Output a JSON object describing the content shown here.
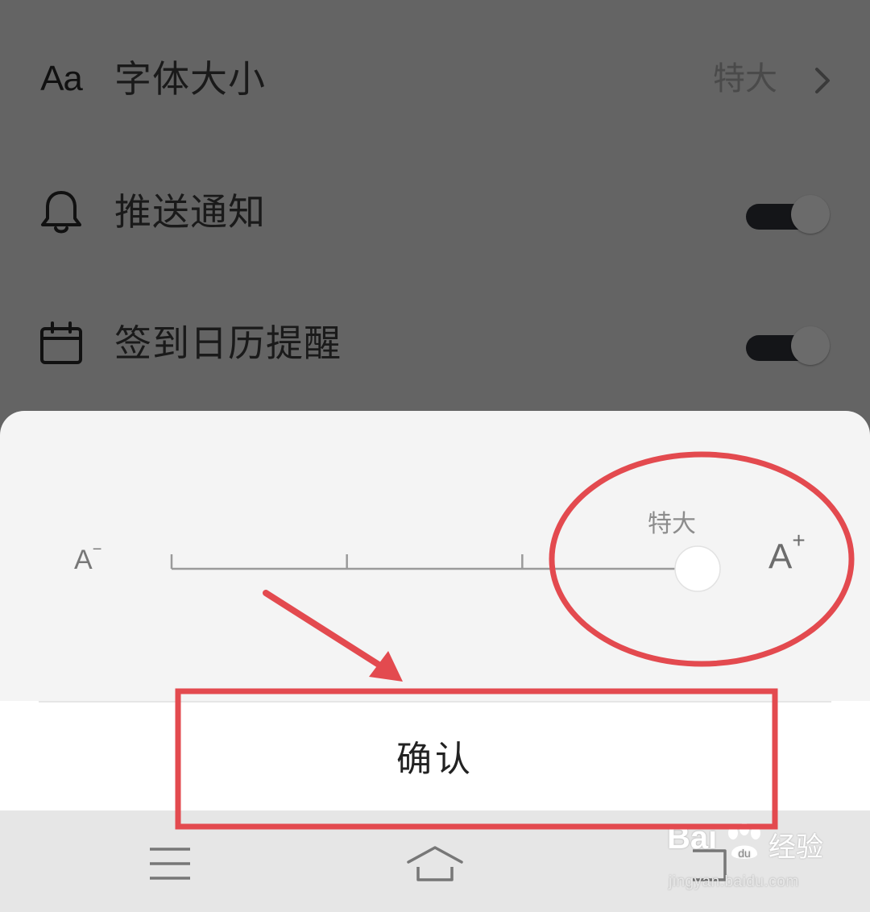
{
  "settings": {
    "font_size": {
      "label": "字体大小",
      "value": "特大",
      "icon": "font-size-icon"
    },
    "push": {
      "label": "推送通知",
      "icon": "bell-icon",
      "enabled": true
    },
    "calendar": {
      "label": "签到日历提醒",
      "icon": "calendar-icon",
      "enabled": true
    },
    "aa_glyph": "Aa"
  },
  "font_sheet": {
    "level_label": "特大",
    "min_glyph": "A",
    "min_sup": "−",
    "max_glyph": "A",
    "max_sup": "+",
    "levels": 4,
    "selected_index": 3,
    "confirm_label": "确认"
  },
  "navbar": {
    "icons": [
      "menu-icon",
      "home-icon",
      "back-icon"
    ]
  },
  "watermark": {
    "brand": "Bai",
    "cn": "经验",
    "url": "jingyan.baidu.com"
  },
  "colors": {
    "annotation": "#e34a4f",
    "dim_overlay": "#646464",
    "sheet_bg": "#f4f4f4"
  }
}
